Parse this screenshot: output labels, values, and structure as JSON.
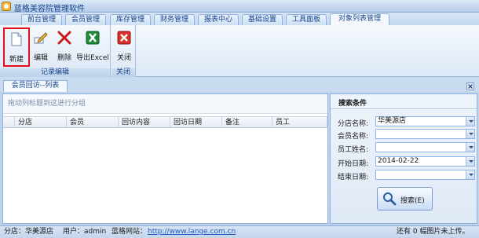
{
  "window": {
    "title": "蓝格美容院管理软件"
  },
  "tabs": [
    {
      "label": "前台管理"
    },
    {
      "label": "会员管理"
    },
    {
      "label": "库存管理"
    },
    {
      "label": "财务管理"
    },
    {
      "label": "报表中心"
    },
    {
      "label": "基础设置"
    },
    {
      "label": "工具面板"
    },
    {
      "label": "对象列表管理"
    }
  ],
  "ribbon": {
    "groups": [
      {
        "label": "记录编辑"
      },
      {
        "label": "关闭"
      }
    ],
    "buttons": {
      "new": "新建",
      "edit": "编辑",
      "delete": "删除",
      "export": "导出Excel",
      "close": "关闭"
    }
  },
  "document_tab": {
    "label": "会员回访--列表"
  },
  "grid": {
    "group_hint": "拖动列标题到这进行分组",
    "columns": [
      "分店",
      "会员",
      "回访内容",
      "回访日期",
      "备注",
      "员工"
    ]
  },
  "search": {
    "title": "搜索条件",
    "fields": [
      {
        "label": "分店名称:",
        "value": "华美源店"
      },
      {
        "label": "会员名称:",
        "value": ""
      },
      {
        "label": "员工姓名:",
        "value": ""
      },
      {
        "label": "开始日期:",
        "value": "2014-02-22"
      },
      {
        "label": "结束日期:",
        "value": ""
      }
    ],
    "button": "搜索(E)"
  },
  "status": {
    "branch": "分店：华美源店",
    "user": "用户：admin",
    "site_label": "蓝格网站：",
    "site_url": "http://www.lange.com.cn",
    "upload": "还有 0 幅图片未上传。"
  },
  "colors": {
    "accent": "#15428b",
    "highlight_border": "#e3101b"
  }
}
